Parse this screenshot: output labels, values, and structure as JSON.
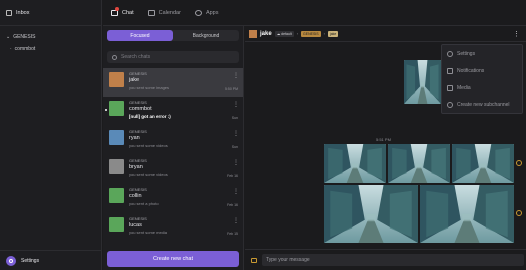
{
  "sidebar": {
    "inbox_label": "Inbox",
    "group_title": "GENESIS",
    "group_item": "commbot",
    "settings_label": "Settings"
  },
  "tabs": [
    {
      "label": "Chat",
      "icon": "chat-icon",
      "active": true
    },
    {
      "label": "Calendar",
      "icon": "calendar-icon",
      "active": false
    },
    {
      "label": "Apps",
      "icon": "globe-icon",
      "active": false
    }
  ],
  "chat_list": {
    "segments": [
      "Focused",
      "Background"
    ],
    "search_placeholder": "Search chats",
    "create_label": "Create new chat",
    "rows": [
      {
        "group": "GENESIS",
        "name": "jake",
        "preview": "you sent some images",
        "time": "5:50 PM",
        "avatar_color": "#c0804a",
        "selected": true,
        "unread": false
      },
      {
        "group": "GENESIS",
        "name": "commbot",
        "preview": "[null] got an error :)",
        "time": "Sun",
        "avatar_color": "#5aa65a",
        "selected": false,
        "unread": true
      },
      {
        "group": "GENESIS",
        "name": "ryan",
        "preview": "you sent some videos",
        "time": "Sun",
        "avatar_color": "#5a8ab8",
        "selected": false,
        "unread": false
      },
      {
        "group": "GENESIS",
        "name": "bryan",
        "preview": "you sent some videos",
        "time": "Feb 16",
        "avatar_color": "#8a8a8a",
        "selected": false,
        "unread": false
      },
      {
        "group": "GENESIS",
        "name": "collin",
        "preview": "you sent a photo",
        "time": "Feb 16",
        "avatar_color": "#5aa65a",
        "selected": false,
        "unread": false
      },
      {
        "group": "GENESIS",
        "name": "lucas",
        "preview": "you sent some media",
        "time": "Feb 15",
        "avatar_color": "#5aa65a",
        "selected": false,
        "unread": false
      },
      {
        "group": "GENESIS",
        "name": "",
        "preview": "",
        "time": "",
        "avatar_color": "#5aa65a",
        "selected": false,
        "unread": false
      }
    ]
  },
  "conversation": {
    "name": "jake",
    "chip_default": "default",
    "chip_genesis": "GENESIS",
    "chip_jake": "jake",
    "timestamp": "5:51 PM",
    "composer_placeholder": "Type your message",
    "menu": [
      {
        "label": "Settings",
        "icon": "gear-icon"
      },
      {
        "label": "Notifications",
        "icon": "bell-icon"
      },
      {
        "label": "Media",
        "icon": "image-icon"
      },
      {
        "label": "Create new subchannel",
        "icon": "plus-circle-icon"
      }
    ]
  },
  "colors": {
    "accent": "#7b5fd6",
    "background": "#1b1b1d",
    "panel": "#1e1e21",
    "reaction": "#c99a32"
  }
}
